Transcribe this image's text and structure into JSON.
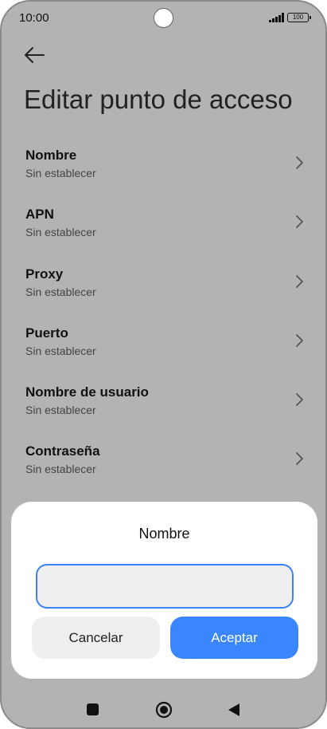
{
  "status_bar": {
    "time": "10:00",
    "battery": "100",
    "icons": [
      "signal-icon",
      "battery-icon"
    ]
  },
  "header": {
    "back_icon": "arrow-left-icon",
    "title": "Editar punto de acceso"
  },
  "settings": {
    "items": [
      {
        "label": "Nombre",
        "value": "Sin establecer"
      },
      {
        "label": "APN",
        "value": "Sin establecer"
      },
      {
        "label": "Proxy",
        "value": "Sin establecer"
      },
      {
        "label": "Puerto",
        "value": "Sin establecer"
      },
      {
        "label": "Nombre de usuario",
        "value": "Sin establecer"
      },
      {
        "label": "Contraseña",
        "value": "Sin establecer"
      }
    ],
    "chevron_icon": "chevron-right-icon"
  },
  "dialog": {
    "title": "Nombre",
    "input_value": "",
    "cancel_label": "Cancelar",
    "accept_label": "Aceptar"
  },
  "nav_bar": {
    "icons": [
      "recents-square-icon",
      "home-circle-icon",
      "back-triangle-icon"
    ]
  },
  "colors": {
    "accent": "#3a86ff",
    "overlay_background": "#b3b3b3",
    "dialog_background": "#ffffff",
    "input_background": "#efefef"
  }
}
